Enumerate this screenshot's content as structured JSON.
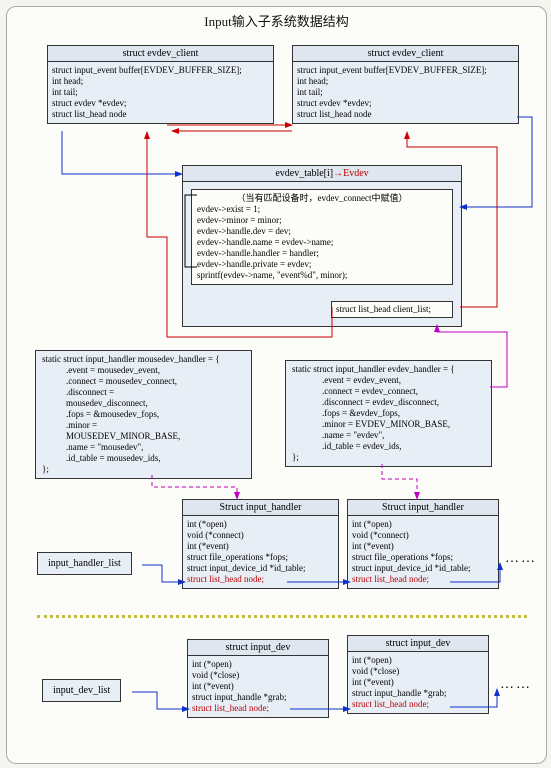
{
  "title": "Input输入子系统数据结构",
  "client": {
    "head": "struct evdev_client",
    "l1": "struct input_event buffer[EVDEV_BUFFER_SIZE];",
    "l2": "int head;",
    "l3": "int tail;",
    "l4": "struct evdev *evdev;",
    "l5": "struct list_head node"
  },
  "evtable": {
    "head_pre": "evdev_table[i]",
    "head_arrow": "→",
    "head_red": "Evdev",
    "l0": "（当有匹配设备时，evdev_connect中赋值）",
    "l1": "evdev->exist = 1;",
    "l2": "evdev->minor = minor;",
    "l3": "evdev->handle.dev = dev;",
    "l4": "evdev->handle.name = evdev->name;",
    "l5": "evdev->handle.handler = handler;",
    "l6": "evdev->handle.private = evdev;",
    "l7": "sprintf(evdev->name, \"event%d\", minor);",
    "client_list": "struct list_head client_list;"
  },
  "mouse_handler": {
    "l1": "static struct input_handler mousedev_handler = {",
    "l2": ".event =   mousedev_event,",
    "l3": ".connect = mousedev_connect,",
    "l4": ".disconnect =",
    "l5": "mousedev_disconnect,",
    "l6": ".fops =    &mousedev_fops,",
    "l7": ".minor =",
    "l8": "MOUSEDEV_MINOR_BASE,",
    "l9": ".name =   \"mousedev\",",
    "l10": ".id_table = mousedev_ids,",
    "l11": "};"
  },
  "evdev_handler": {
    "l1": "static struct input_handler evdev_handler = {",
    "l2": ".event =   evdev_event,",
    "l3": ".connect = evdev_connect,",
    "l4": ".disconnect = evdev_disconnect,",
    "l5": ".fops =    &evdev_fops,",
    "l6": ".minor =  EVDEV_MINOR_BASE,",
    "l7": ".name =   \"evdev\",",
    "l8": ".id_table = evdev_ids,",
    "l9": "};"
  },
  "inputh": {
    "head": "Struct input_handler",
    "l1": "int (*open)",
    "l2": "void (*connect)",
    "l3": "int (*event)",
    "l4": "struct file_operations *fops;",
    "l5": "struct input_device_id *id_table;",
    "l6": "struct list_head node;"
  },
  "inputdev": {
    "head": "struct input_dev",
    "l1": "int (*open)",
    "l2": "void (*close)",
    "l3": "int (*event)",
    "l4": "struct input_handle *grab;",
    "l5": "struct list_head node;"
  },
  "labels": {
    "handler_list": "input_handler_list",
    "dev_list": "input_dev_list",
    "dots": "……"
  }
}
